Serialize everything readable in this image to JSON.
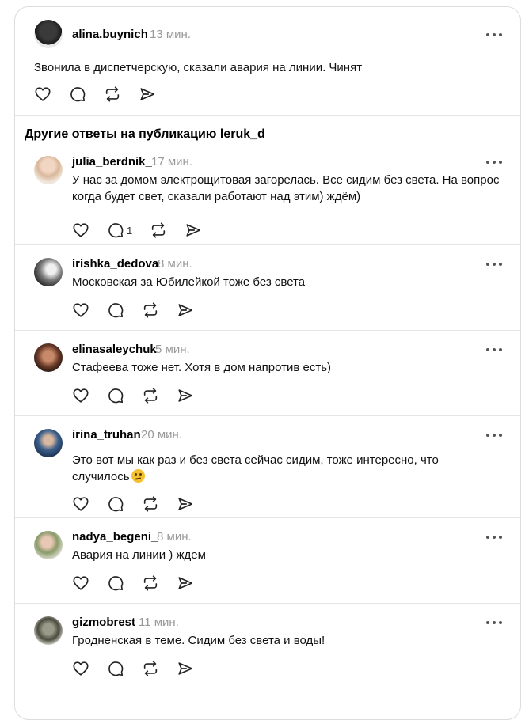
{
  "main_post": {
    "username": "alina.buynich",
    "time": "13 мин.",
    "text": "Звонила в диспетчерскую, сказали авария на линии. Чинят"
  },
  "other_replies_heading": "Другие ответы на публикацию leruk_d",
  "replies": [
    {
      "username": "julia_berdnik_",
      "time": "17 мин.",
      "text": "У нас за домом электрощитовая загорелась. Все сидим без света. На вопрос когда будет свет, сказали работают над этим) ждём)",
      "reply_count": "1"
    },
    {
      "username": "irishka_dedova",
      "time": "8 мин.",
      "text": "Московская за Юбилейкой тоже без света"
    },
    {
      "username": "elinasaleychuk",
      "time": "5 мин.",
      "text": "Стафеева тоже нет. Хотя в дом напротив есть)"
    },
    {
      "username": "irina_truhan",
      "time": "20 мин.",
      "text": "Это вот мы как раз и без света сейчас сидим, тоже интересно, что случилось"
    },
    {
      "username": "nadya_begeni_",
      "time": "8 мин.",
      "text": "Авария на линии ) ждем"
    },
    {
      "username": "gizmobrest",
      "time": "11 мин.",
      "text": "Гродненская в теме. Сидим без света и воды!"
    }
  ],
  "icons": {
    "like": "heart-icon",
    "comment": "comment-icon",
    "repost": "repost-icon",
    "share": "send-icon",
    "more": "more-icon"
  },
  "colors": {
    "time_gray": "#999999",
    "divider": "#e6e6e6",
    "emoji": "#f5c030"
  }
}
